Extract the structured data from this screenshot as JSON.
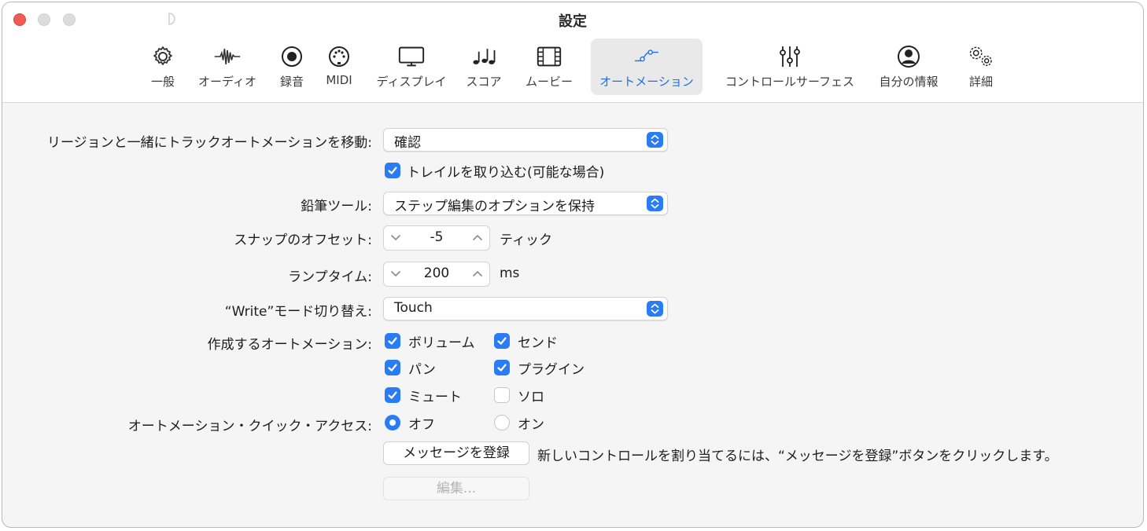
{
  "window": {
    "title": "設定"
  },
  "toolbar": {
    "items": [
      {
        "label": "一般",
        "icon": "gear-icon"
      },
      {
        "label": "オーディオ",
        "icon": "waveform-icon"
      },
      {
        "label": "録音",
        "icon": "record-icon"
      },
      {
        "label": "MIDI",
        "icon": "midi-connector-icon"
      },
      {
        "label": "ディスプレイ",
        "icon": "display-icon"
      },
      {
        "label": "スコア",
        "icon": "music-notes-icon"
      },
      {
        "label": "ムービー",
        "icon": "film-icon"
      },
      {
        "label": "オートメーション",
        "icon": "automation-curve-icon",
        "selected": true
      },
      {
        "label": "コントロールサーフェス",
        "icon": "sliders-icon"
      },
      {
        "label": "自分の情報",
        "icon": "person-circle-icon"
      },
      {
        "label": "詳細",
        "icon": "gears-icon"
      }
    ]
  },
  "settings": {
    "move_automation": {
      "label": "リージョンと一緒にトラックオートメーションを移動:",
      "value": "確認"
    },
    "include_trails": {
      "label": "トレイルを取り込む(可能な場合)",
      "checked": true
    },
    "pencil_tool": {
      "label": "鉛筆ツール:",
      "value": "ステップ編集のオプションを保持"
    },
    "snap_offset": {
      "label": "スナップのオフセット:",
      "value": "-5",
      "unit": "ティック"
    },
    "ramp_time": {
      "label": "ランプタイム:",
      "value": "200",
      "unit": "ms"
    },
    "write_mode": {
      "label": "“Write”モード切り替え:",
      "value": "Touch"
    },
    "create_automation": {
      "label": "作成するオートメーション:",
      "options": [
        {
          "label": "ボリューム",
          "checked": true
        },
        {
          "label": "センド",
          "checked": true
        },
        {
          "label": "パン",
          "checked": true
        },
        {
          "label": "プラグイン",
          "checked": true
        },
        {
          "label": "ミュート",
          "checked": true
        },
        {
          "label": "ソロ",
          "checked": false
        }
      ]
    },
    "quick_access": {
      "label": "オートメーション・クイック・アクセス:",
      "options": [
        {
          "label": "オフ",
          "selected": true
        },
        {
          "label": "オン",
          "selected": false
        }
      ]
    },
    "learn_message": {
      "button_label": "メッセージを登録",
      "hint": "新しいコントロールを割り当てるには、“メッセージを登録”ボタンをクリックします。"
    },
    "edit_button": {
      "label": "編集..."
    }
  },
  "colors": {
    "accent": "#2a7cf6",
    "selected_tab_text": "#1f6fe6",
    "close_button": "#ee5c54"
  }
}
